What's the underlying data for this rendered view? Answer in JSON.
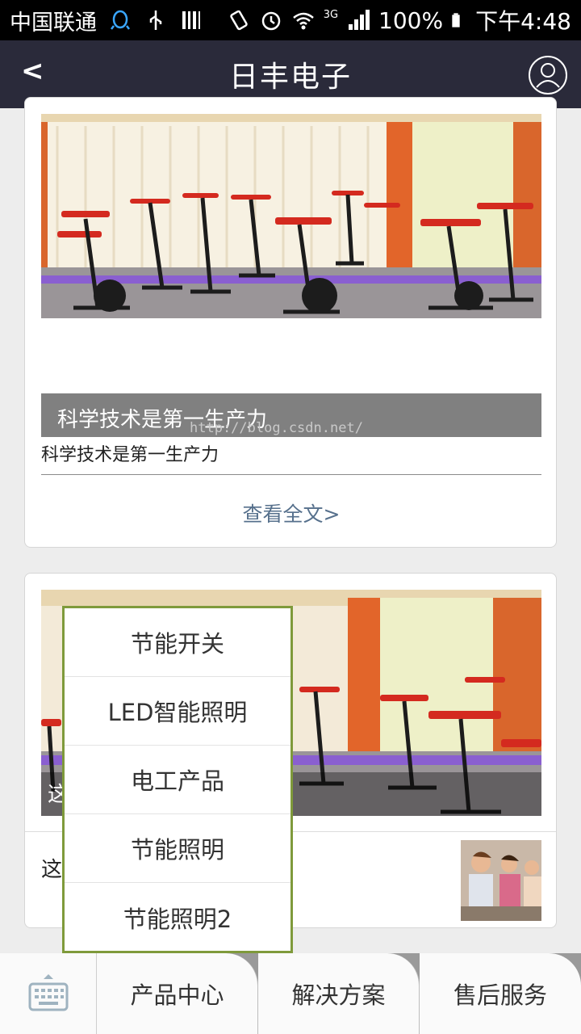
{
  "status_bar": {
    "carrier": "中国联通",
    "network": "3G",
    "battery": "100%",
    "time": "下午4:48"
  },
  "nav": {
    "back_label": "<",
    "title": "日丰电子"
  },
  "article_card": {
    "caption": "科学技术是第一生产力",
    "summary": "科学技术是第一生产力",
    "read_more": "查看全文>",
    "watermark": "http://blog.csdn.net/"
  },
  "second_card": {
    "overlay_char": "这",
    "row_text": "这"
  },
  "popup_menu": {
    "items": [
      "节能开关",
      "LED智能照明",
      "电工产品",
      "节能照明",
      "节能照明2"
    ]
  },
  "bottom_bar": {
    "tabs": [
      "产品中心",
      "解决方案",
      "售后服务"
    ]
  },
  "colors": {
    "nav_bg": "#2a2a3a",
    "popup_border": "#7f9a3b",
    "caption_bg": "#808080",
    "link": "#56708c"
  }
}
